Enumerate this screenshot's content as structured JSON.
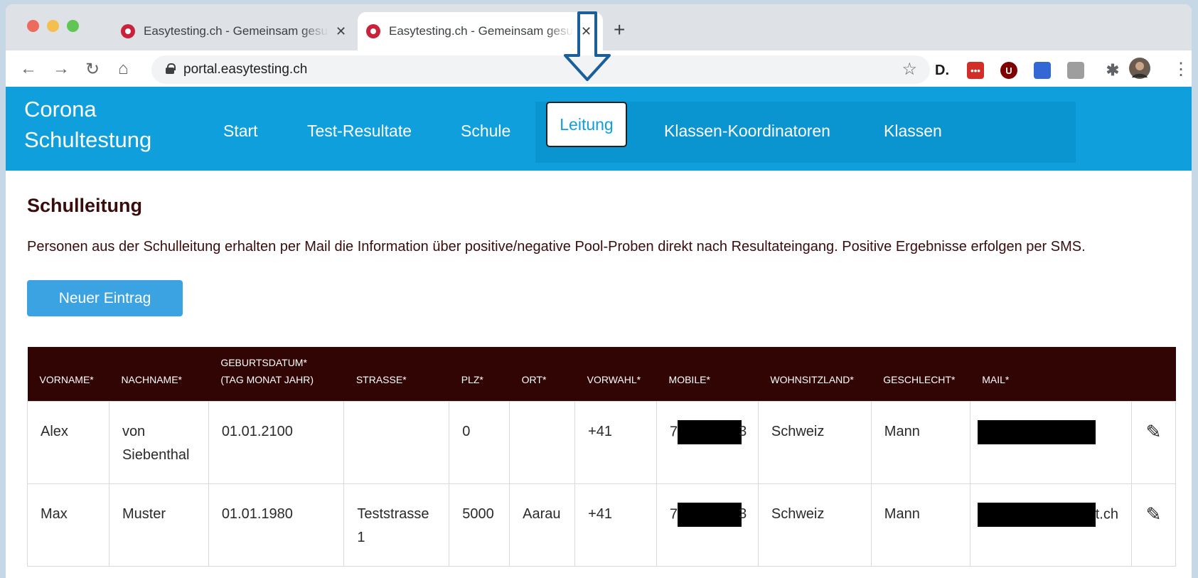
{
  "browser": {
    "tabs": [
      {
        "title": "Easytesting.ch - Gemeinsam gesund",
        "close": "✕"
      },
      {
        "title": "Easytesting.ch - Gemeinsam gesund",
        "close": "✕"
      }
    ],
    "new_tab": "+",
    "url": "portal.easytesting.ch",
    "back": "←",
    "forward": "→",
    "reload": "↻",
    "home": "⌂",
    "star": "☆",
    "menu": "⋮",
    "extensions": [
      {
        "name": "d-extension",
        "label": "D.",
        "color": "#1a1a1a"
      },
      {
        "name": "lastpass-extension",
        "label": "•••",
        "color": "#d32d27"
      },
      {
        "name": "ublock-extension",
        "label": "U",
        "color": "#800000"
      },
      {
        "name": "bookmark-extension",
        "label": "",
        "color": "#3367d6"
      },
      {
        "name": "briefcase-extension",
        "label": "",
        "color": "#9e9e9e"
      },
      {
        "name": "puzzle-extension",
        "label": "✱",
        "color": "#5f6368"
      }
    ]
  },
  "app": {
    "brand_line1": "Corona",
    "brand_line2": "Schultestung",
    "nav": [
      "Start",
      "Test-Resultate",
      "Schule",
      "Leitung",
      "Klassen-Koordinatoren",
      "Klassen"
    ],
    "active_nav": "Leitung"
  },
  "page": {
    "title": "Schulleitung",
    "description": "Personen aus der Schulleitung erhalten per Mail die Information über positive/negative Pool-Proben direkt nach Resultateingang. Positive Ergebnisse erfolgen per SMS.",
    "new_button": "Neuer Eintrag"
  },
  "table": {
    "headers": [
      "VORNAME*",
      "NACHNAME*",
      "GEBURTSDATUM*",
      "(TAG MONAT JAHR)",
      "STRASSE*",
      "PLZ*",
      "ORT*",
      "VORWAHL*",
      "MOBILE*",
      "WOHNSITZLAND*",
      "GESCHLECHT*",
      "MAIL*"
    ],
    "rows": [
      {
        "vorname": "Alex",
        "nachname": "von Siebenthal",
        "geburtsdatum": "01.01.2100",
        "strasse": "",
        "plz": "0",
        "ort": "",
        "vorwahl": "+41",
        "mobile_start": "7",
        "mobile_end": "3",
        "land": "Schweiz",
        "geschlecht": "Mann",
        "mail_end": ""
      },
      {
        "vorname": "Max",
        "nachname": "Muster",
        "geburtsdatum": "01.01.1980",
        "strasse": "Teststrasse 1",
        "plz": "5000",
        "ort": "Aarau",
        "vorwahl": "+41",
        "mobile_start": "7",
        "mobile_end": "3",
        "land": "Schweiz",
        "geschlecht": "Mann",
        "mail_end": "t.ch"
      }
    ],
    "edit_icon": "✎"
  }
}
